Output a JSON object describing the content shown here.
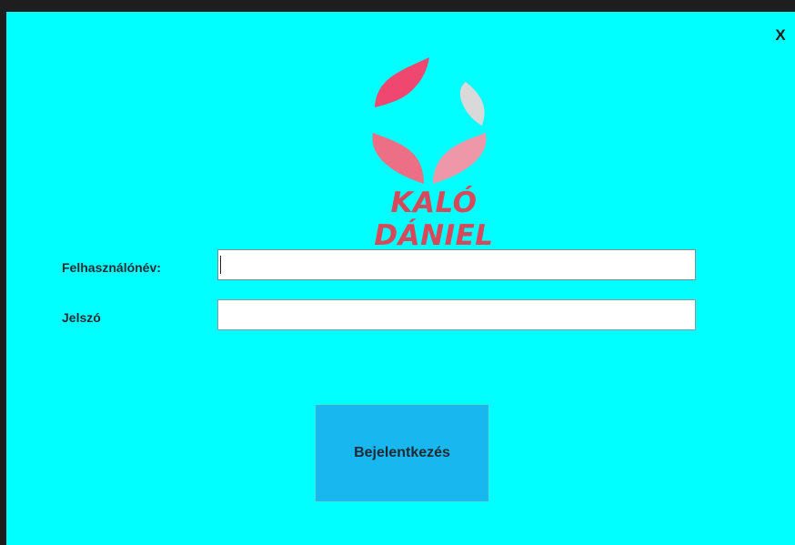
{
  "window": {
    "close_label": "X",
    "background": "#00ffff"
  },
  "branding": {
    "name": "KALÓ DÁNIEL",
    "color": "#d9475a",
    "logo_icon": "diamond-petal-logo-icon"
  },
  "form": {
    "username_label": "Felhasználónév:",
    "username_value": "",
    "password_label": "Jelszó",
    "password_value": ""
  },
  "actions": {
    "login_label": "Bejelentkezés",
    "login_color": "#18b7f0"
  }
}
